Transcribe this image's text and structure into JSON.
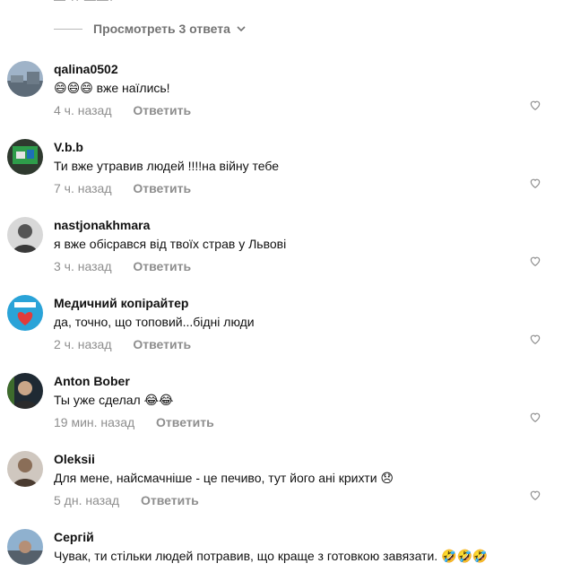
{
  "top_partial": "— ·· ——·",
  "view_replies": {
    "label": "Просмотреть 3 ответа"
  },
  "comments": [
    {
      "username": "qalina0502",
      "text": "😄😄😄 вже наїлись!",
      "time": "4 ч. назад",
      "reply": "Ответить",
      "avatar": "landscape-photo-avatar"
    },
    {
      "username": "V.b.b",
      "text": "Ти вже утравив людей !!!!на війну тебе",
      "time": "7 ч. назад",
      "reply": "Ответить",
      "avatar": "green-screen-avatar"
    },
    {
      "username": "nastjonakhmara",
      "text": "я вже обісрався від твоїх страв у Львові",
      "time": "3 ч. назад",
      "reply": "Ответить",
      "avatar": "portrait-bw-avatar"
    },
    {
      "username": "Медичний копірайтер",
      "text": "да, точно, що топовий...бідні люди",
      "time": "2 ч. назад",
      "reply": "Ответить",
      "avatar": "blue-heart-logo-avatar"
    },
    {
      "username": "Anton Bober",
      "text": "Ты уже сделал 😂😂",
      "time": "19 мин. назад",
      "reply": "Ответить",
      "avatar": "man-in-car-avatar"
    },
    {
      "username": "Oleksii",
      "text": "Для мене, найсмачніше - це печиво, тут його ані крихти 😞",
      "time": "5 дн. назад",
      "reply": "Ответить",
      "avatar": "portrait-sepia-avatar"
    },
    {
      "username": "Сергій",
      "text": "Чувак, ти стільки людей потравив, що краще з готовкою завязати. 🤣🤣🤣",
      "time": "",
      "reply": "",
      "avatar": "street-photo-avatar"
    }
  ],
  "colors": {
    "muted": "#8e8e8e",
    "text": "#111111",
    "divider": "#b8b8b8"
  }
}
